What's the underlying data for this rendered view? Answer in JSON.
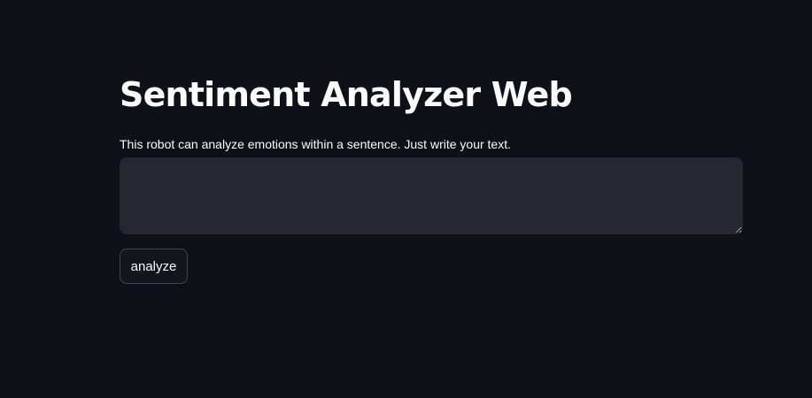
{
  "page": {
    "title": "Sentiment Analyzer Web"
  },
  "input": {
    "label": "This robot can analyze emotions within a sentence. Just write your text.",
    "value": "",
    "placeholder": ""
  },
  "actions": {
    "analyze_label": "analyze"
  },
  "colors": {
    "background": "#0e1117",
    "input_background": "#262730",
    "text": "#fafafa",
    "button_border": "#41444c"
  }
}
